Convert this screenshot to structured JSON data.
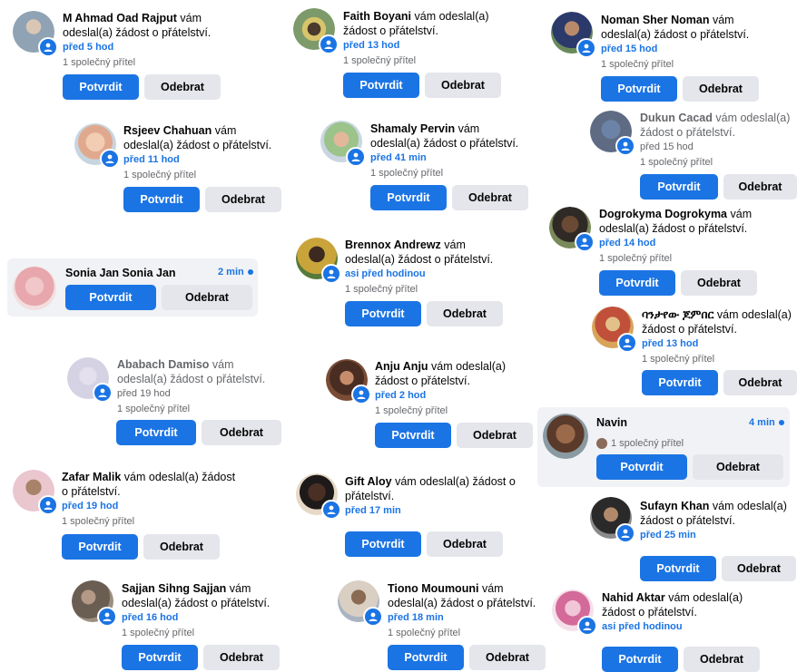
{
  "accent_color": "#1b74e4",
  "requests": [
    {
      "name": "M Ahmad Oad Rajput",
      "message": "vám odeslal(a) žádost o přátelství.",
      "time": "před 5 hod",
      "mutual": "1 společný přítel",
      "confirm": "Potvrdit",
      "remove": "Odebrat"
    },
    {
      "name": "Rsjeev Chahuan",
      "message": "vám odeslal(a) žádost o přátelství.",
      "time": "před 11 hod",
      "mutual": "1 společný přítel",
      "confirm": "Potvrdit",
      "remove": "Odebrat"
    },
    {
      "name": "Sonia Jan Sonia Jan",
      "time": "2 min",
      "confirm": "Potvrdit",
      "remove": "Odebrat"
    },
    {
      "name": "Ababach Damiso",
      "message": "vám odeslal(a) žádost o přátelství.",
      "time": "před 19 hod",
      "mutual": "1 společný přítel",
      "confirm": "Potvrdit",
      "remove": "Odebrat"
    },
    {
      "name": "Zafar Malik",
      "message": "vám odeslal(a) žádost o přátelství.",
      "time": "před 19 hod",
      "mutual": "1 společný přítel",
      "confirm": "Potvrdit",
      "remove": "Odebrat"
    },
    {
      "name": "Sajjan Sihng Sajjan",
      "message": "vám odeslal(a) žádost o přátelství.",
      "time": "před 16 hod",
      "mutual": "1 společný přítel",
      "confirm": "Potvrdit",
      "remove": "Odebrat"
    },
    {
      "name": "Faith Boyani",
      "message": "vám odeslal(a) žádost o přátelství.",
      "time": "před 13 hod",
      "mutual": "1 společný přítel",
      "confirm": "Potvrdit",
      "remove": "Odebrat"
    },
    {
      "name": "Shamaly Pervin",
      "message": "vám odeslal(a) žádost o přátelství.",
      "time": "před 41 min",
      "mutual": "1 společný přítel",
      "confirm": "Potvrdit",
      "remove": "Odebrat"
    },
    {
      "name": "Brennox Andrewz",
      "message": "vám odeslal(a) žádost o přátelství.",
      "time": "asi před hodinou",
      "mutual": "1 společný přítel",
      "confirm": "Potvrdit",
      "remove": "Odebrat"
    },
    {
      "name": "Anju Anju",
      "message": "vám odeslal(a) žádost o přátelství.",
      "time": "před 2 hod",
      "mutual": "1 společný přítel",
      "confirm": "Potvrdit",
      "remove": "Odebrat"
    },
    {
      "name": "Gift Aloy",
      "message": "vám odeslal(a) žádost o přátelství.",
      "time": "před 17 min",
      "confirm": "Potvrdit",
      "remove": "Odebrat"
    },
    {
      "name": "Tiono Moumouni",
      "message": "vám odeslal(a) žádost o přátelství.",
      "time": "před 18 min",
      "mutual": "1 společný přítel",
      "confirm": "Potvrdit",
      "remove": "Odebrat"
    },
    {
      "name": "Noman Sher Noman",
      "message": "vám odeslal(a) žádost o přátelství.",
      "time": "před 15 hod",
      "mutual": "1 společný přítel",
      "confirm": "Potvrdit",
      "remove": "Odebrat"
    },
    {
      "name": "Dukun Cacad",
      "message": "vám odeslal(a) žádost o přátelství.",
      "time": "před 15 hod",
      "mutual": "1 společný přítel",
      "confirm": "Potvrdit",
      "remove": "Odebrat"
    },
    {
      "name": "Dogrokyma Dogrokyma",
      "message": "vám odeslal(a) žádost o přátelství.",
      "time": "před 14 hod",
      "mutual": "1 společný přítel",
      "confirm": "Potvrdit",
      "remove": "Odebrat"
    },
    {
      "name": "ባንታየው ጆምበር",
      "message": "vám odeslal(a) žádost o přátelství.",
      "time": "před 13 hod",
      "mutual": "1 společný přítel",
      "confirm": "Potvrdit",
      "remove": "Odebrat"
    },
    {
      "name": "Navin",
      "time": "4 min",
      "mutual": "1 společný přítel",
      "confirm": "Potvrdit",
      "remove": "Odebrat"
    },
    {
      "name": "Sufayn Khan",
      "message": "vám odeslal(a) žádost o přátelství.",
      "time": "před 25 min",
      "confirm": "Potvrdit",
      "remove": "Odebrat"
    },
    {
      "name": "Nahid Aktar",
      "message": "vám odeslal(a) žádost o přátelství.",
      "time": "asi před hodinou",
      "confirm": "Potvrdit",
      "remove": "Odebrat"
    }
  ]
}
